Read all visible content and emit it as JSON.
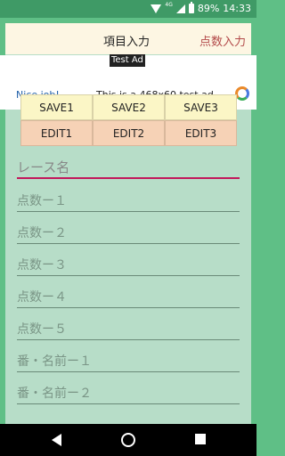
{
  "status": {
    "network": "4G",
    "battery": "89%",
    "time": "14:33"
  },
  "tabs": [
    {
      "label": "項目入力"
    },
    {
      "label": "点数入力"
    }
  ],
  "ad": {
    "label": "Test Ad",
    "nice": "Nice job!",
    "text": "This is a 468x60 test ad."
  },
  "buttons": {
    "save": [
      "SAVE1",
      "SAVE2",
      "SAVE3"
    ],
    "edit": [
      "EDIT1",
      "EDIT2",
      "EDIT3"
    ]
  },
  "fields": [
    {
      "placeholder": "レース名"
    },
    {
      "placeholder": "点数ー１"
    },
    {
      "placeholder": "点数ー２"
    },
    {
      "placeholder": "点数ー３"
    },
    {
      "placeholder": "点数ー４"
    },
    {
      "placeholder": "点数ー５"
    },
    {
      "placeholder": "番・名前ー１"
    },
    {
      "placeholder": "番・名前ー２"
    }
  ]
}
